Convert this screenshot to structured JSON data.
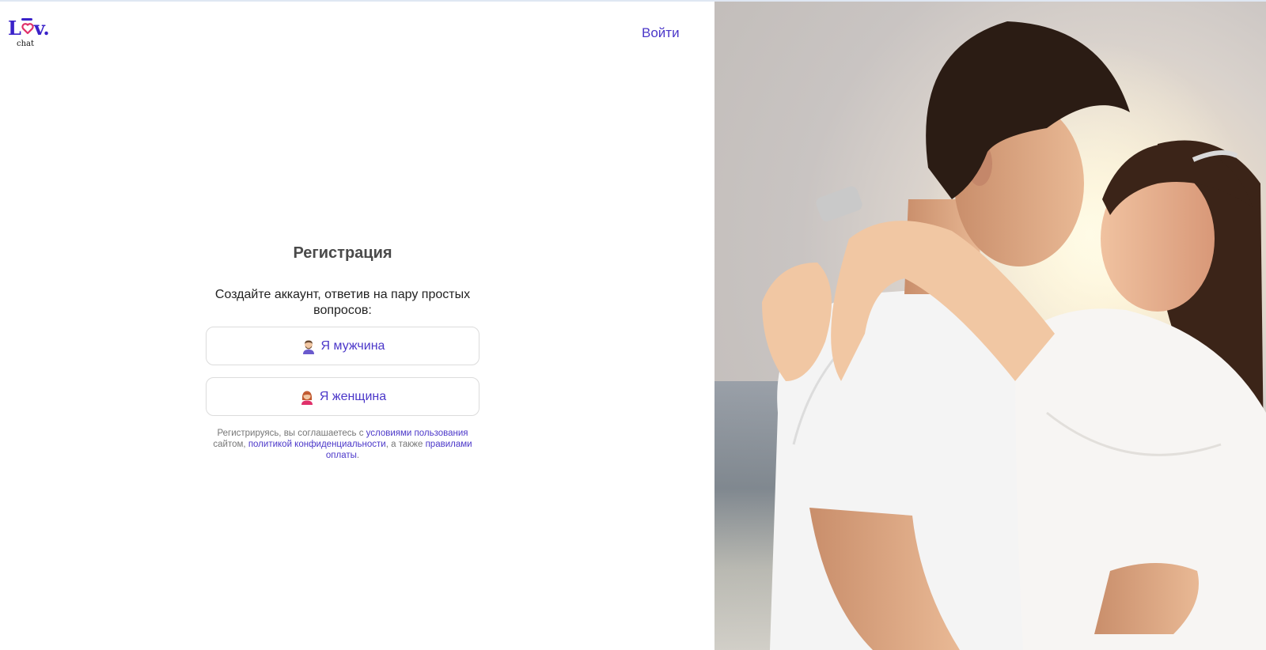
{
  "logo": {
    "letters": [
      "L",
      "o",
      "v",
      "."
    ],
    "subtitle": "chat",
    "colors": {
      "primary": "#3a22c9",
      "accent": "#e0306a"
    }
  },
  "header": {
    "login_label": "Войти"
  },
  "form": {
    "title": "Регистрация",
    "subtitle": "Создайте аккаунт, ответив на пару простых вопросов:",
    "male_label": "Я мужчина",
    "female_label": "Я женщина",
    "male_icon": "man-emoji-icon",
    "female_icon": "woman-emoji-icon"
  },
  "terms": {
    "text_1": "Регистрируясь, вы соглашаетесь с ",
    "link_1": "условиями пользования",
    "text_2": " сайтом, ",
    "link_2": "политикой конфиденциальности",
    "text_3": ", а также ",
    "link_3": "правилами оплаты",
    "text_4": "."
  },
  "theme": {
    "accent": "#4b37c9",
    "border": "#dcdcdc",
    "title_color": "#4a4a4a"
  },
  "hero_image": {
    "subject": "couple-embracing-photo"
  }
}
